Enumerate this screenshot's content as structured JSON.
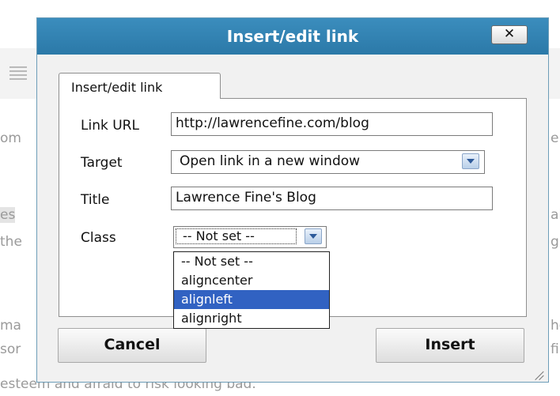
{
  "dialog": {
    "title": "Insert/edit link",
    "close_label": "✕",
    "tab_label": "Insert/edit link",
    "fields": {
      "url": {
        "label": "Link URL",
        "value": "http://lawrencefine.com/blog"
      },
      "target": {
        "label": "Target",
        "value": "Open link in a new window"
      },
      "title": {
        "label": "Title",
        "value": "Lawrence Fine's Blog"
      },
      "class": {
        "label": "Class",
        "value": "-- Not set --"
      }
    },
    "class_options": [
      "-- Not set --",
      "aligncenter",
      "alignleft",
      "alignright"
    ],
    "class_selected_option": "alignleft",
    "cancel_label": "Cancel",
    "insert_label": "Insert"
  },
  "background": {
    "frag_1": "om",
    "frag_2": "es",
    "frag_3": "the",
    "frag_4": "ma",
    "frag_5": "sor",
    "frag_6": "e",
    "frag_7": "all",
    "frag_8": "g b",
    "frag_9": "he",
    "frag_10": "fir",
    "bottom_line": "esteem and afraid to risk looking bad."
  },
  "colors": {
    "titlebar": "#3384b4",
    "selected_option": "#3162c2",
    "background_text": "#9a9a9a"
  },
  "icons": {
    "close": "close-icon",
    "dropdown": "chevron-down-icon",
    "align": "align-justify-icon",
    "resize": "resize-grip-icon"
  }
}
